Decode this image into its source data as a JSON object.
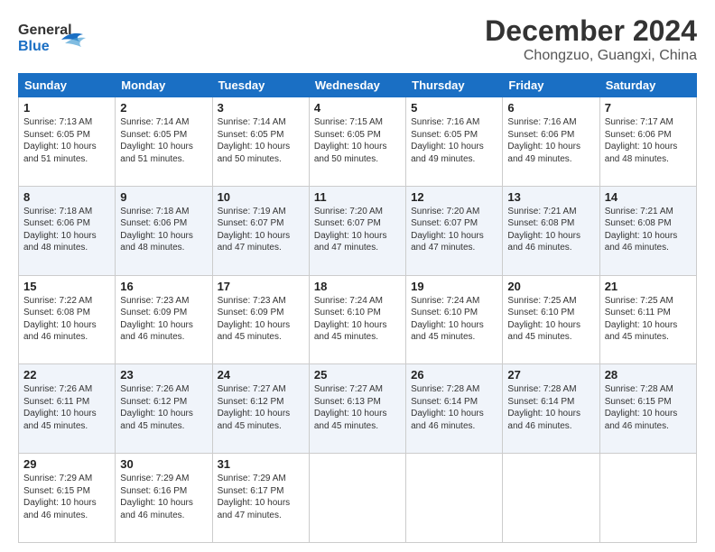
{
  "header": {
    "logo_line1": "General",
    "logo_line2": "Blue",
    "month": "December 2024",
    "location": "Chongzuo, Guangxi, China"
  },
  "days_of_week": [
    "Sunday",
    "Monday",
    "Tuesday",
    "Wednesday",
    "Thursday",
    "Friday",
    "Saturday"
  ],
  "weeks": [
    [
      {
        "day": "1",
        "info": "Sunrise: 7:13 AM\nSunset: 6:05 PM\nDaylight: 10 hours\nand 51 minutes."
      },
      {
        "day": "2",
        "info": "Sunrise: 7:14 AM\nSunset: 6:05 PM\nDaylight: 10 hours\nand 51 minutes."
      },
      {
        "day": "3",
        "info": "Sunrise: 7:14 AM\nSunset: 6:05 PM\nDaylight: 10 hours\nand 50 minutes."
      },
      {
        "day": "4",
        "info": "Sunrise: 7:15 AM\nSunset: 6:05 PM\nDaylight: 10 hours\nand 50 minutes."
      },
      {
        "day": "5",
        "info": "Sunrise: 7:16 AM\nSunset: 6:05 PM\nDaylight: 10 hours\nand 49 minutes."
      },
      {
        "day": "6",
        "info": "Sunrise: 7:16 AM\nSunset: 6:06 PM\nDaylight: 10 hours\nand 49 minutes."
      },
      {
        "day": "7",
        "info": "Sunrise: 7:17 AM\nSunset: 6:06 PM\nDaylight: 10 hours\nand 48 minutes."
      }
    ],
    [
      {
        "day": "8",
        "info": "Sunrise: 7:18 AM\nSunset: 6:06 PM\nDaylight: 10 hours\nand 48 minutes."
      },
      {
        "day": "9",
        "info": "Sunrise: 7:18 AM\nSunset: 6:06 PM\nDaylight: 10 hours\nand 48 minutes."
      },
      {
        "day": "10",
        "info": "Sunrise: 7:19 AM\nSunset: 6:07 PM\nDaylight: 10 hours\nand 47 minutes."
      },
      {
        "day": "11",
        "info": "Sunrise: 7:20 AM\nSunset: 6:07 PM\nDaylight: 10 hours\nand 47 minutes."
      },
      {
        "day": "12",
        "info": "Sunrise: 7:20 AM\nSunset: 6:07 PM\nDaylight: 10 hours\nand 47 minutes."
      },
      {
        "day": "13",
        "info": "Sunrise: 7:21 AM\nSunset: 6:08 PM\nDaylight: 10 hours\nand 46 minutes."
      },
      {
        "day": "14",
        "info": "Sunrise: 7:21 AM\nSunset: 6:08 PM\nDaylight: 10 hours\nand 46 minutes."
      }
    ],
    [
      {
        "day": "15",
        "info": "Sunrise: 7:22 AM\nSunset: 6:08 PM\nDaylight: 10 hours\nand 46 minutes."
      },
      {
        "day": "16",
        "info": "Sunrise: 7:23 AM\nSunset: 6:09 PM\nDaylight: 10 hours\nand 46 minutes."
      },
      {
        "day": "17",
        "info": "Sunrise: 7:23 AM\nSunset: 6:09 PM\nDaylight: 10 hours\nand 45 minutes."
      },
      {
        "day": "18",
        "info": "Sunrise: 7:24 AM\nSunset: 6:10 PM\nDaylight: 10 hours\nand 45 minutes."
      },
      {
        "day": "19",
        "info": "Sunrise: 7:24 AM\nSunset: 6:10 PM\nDaylight: 10 hours\nand 45 minutes."
      },
      {
        "day": "20",
        "info": "Sunrise: 7:25 AM\nSunset: 6:10 PM\nDaylight: 10 hours\nand 45 minutes."
      },
      {
        "day": "21",
        "info": "Sunrise: 7:25 AM\nSunset: 6:11 PM\nDaylight: 10 hours\nand 45 minutes."
      }
    ],
    [
      {
        "day": "22",
        "info": "Sunrise: 7:26 AM\nSunset: 6:11 PM\nDaylight: 10 hours\nand 45 minutes."
      },
      {
        "day": "23",
        "info": "Sunrise: 7:26 AM\nSunset: 6:12 PM\nDaylight: 10 hours\nand 45 minutes."
      },
      {
        "day": "24",
        "info": "Sunrise: 7:27 AM\nSunset: 6:12 PM\nDaylight: 10 hours\nand 45 minutes."
      },
      {
        "day": "25",
        "info": "Sunrise: 7:27 AM\nSunset: 6:13 PM\nDaylight: 10 hours\nand 45 minutes."
      },
      {
        "day": "26",
        "info": "Sunrise: 7:28 AM\nSunset: 6:14 PM\nDaylight: 10 hours\nand 46 minutes."
      },
      {
        "day": "27",
        "info": "Sunrise: 7:28 AM\nSunset: 6:14 PM\nDaylight: 10 hours\nand 46 minutes."
      },
      {
        "day": "28",
        "info": "Sunrise: 7:28 AM\nSunset: 6:15 PM\nDaylight: 10 hours\nand 46 minutes."
      }
    ],
    [
      {
        "day": "29",
        "info": "Sunrise: 7:29 AM\nSunset: 6:15 PM\nDaylight: 10 hours\nand 46 minutes."
      },
      {
        "day": "30",
        "info": "Sunrise: 7:29 AM\nSunset: 6:16 PM\nDaylight: 10 hours\nand 46 minutes."
      },
      {
        "day": "31",
        "info": "Sunrise: 7:29 AM\nSunset: 6:17 PM\nDaylight: 10 hours\nand 47 minutes."
      },
      null,
      null,
      null,
      null
    ]
  ]
}
